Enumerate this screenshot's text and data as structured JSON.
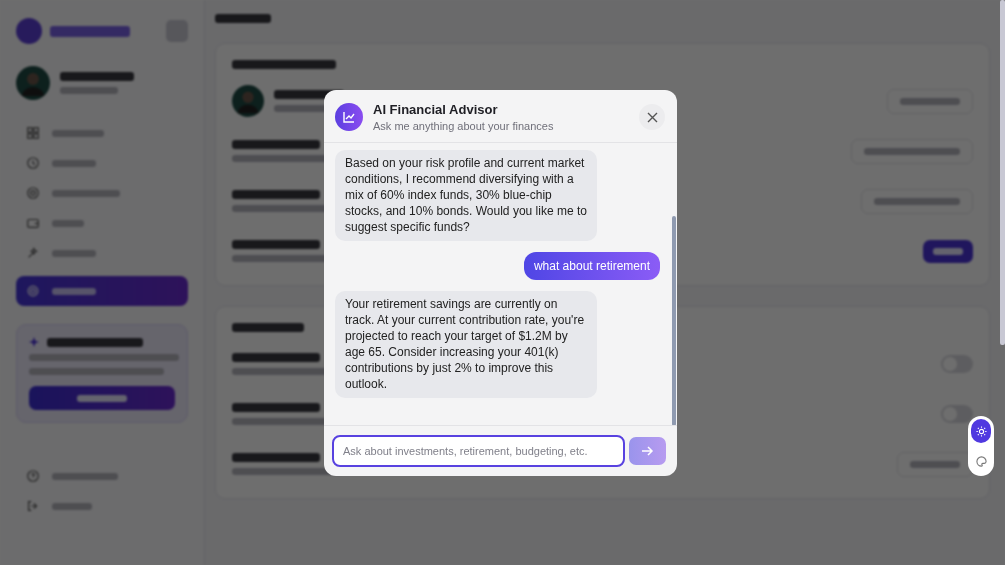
{
  "sidebar": {
    "nav": [
      {
        "kind": "grid",
        "selected": false
      },
      {
        "kind": "clock",
        "selected": false
      },
      {
        "kind": "target",
        "selected": false
      },
      {
        "kind": "wallet",
        "selected": false
      },
      {
        "kind": "spark",
        "selected": false
      },
      {
        "kind": "gear",
        "selected": true
      }
    ],
    "footer": [
      {
        "kind": "help"
      },
      {
        "kind": "exit"
      }
    ]
  },
  "page": {
    "sections": [
      {
        "rows": [
          {
            "kind": "profile"
          },
          {
            "kind": "button"
          },
          {
            "kind": "button"
          },
          {
            "kind": "primary"
          }
        ]
      },
      {
        "rows": [
          {
            "kind": "toggle",
            "on": false
          },
          {
            "kind": "toggle",
            "on": false
          },
          {
            "kind": "button"
          }
        ]
      }
    ]
  },
  "chat": {
    "title": "AI Financial Advisor",
    "subtitle": "Ask me anything about your finances",
    "messages": [
      {
        "kind": "assistant",
        "text": "Based on your risk profile and current market conditions, I recommend diversifying with a mix of 60% index funds, 30% blue-chip stocks, and 10% bonds. Would you like me to suggest specific funds?"
      },
      {
        "kind": "user",
        "text": "what about retirement"
      },
      {
        "kind": "assistant",
        "text": "Your retirement savings are currently on track. At your current contribution rate, you're projected to reach your target of $1.2M by age 65. Consider increasing your 401(k) contributions by just 2% to improve this outlook."
      }
    ],
    "input": {
      "placeholder": "Ask about investments, retirement, budgeting, etc."
    }
  },
  "theme_switcher": {
    "options": [
      {
        "kind": "sun",
        "selected": true
      },
      {
        "kind": "palette",
        "selected": false
      }
    ]
  }
}
